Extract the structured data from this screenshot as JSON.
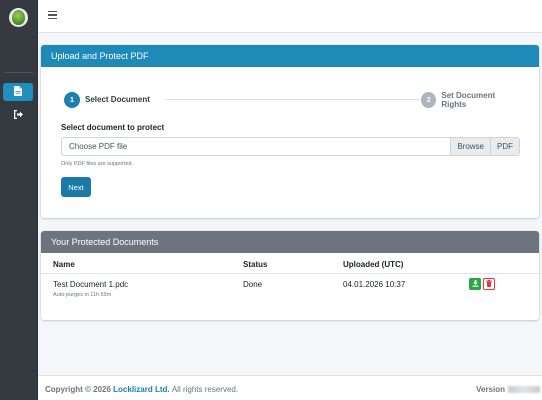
{
  "sidebar": {
    "logo": "app-logo",
    "items": [
      {
        "name": "documents",
        "icon": "file-icon",
        "active": true
      },
      {
        "name": "logout",
        "icon": "sign-out-icon",
        "active": false
      }
    ]
  },
  "topbar": {
    "menu_icon": "hamburger-icon"
  },
  "upload_card": {
    "title": "Upload and Protect PDF",
    "steps": [
      {
        "number": "1",
        "label": "Select Document"
      },
      {
        "number": "2",
        "label": "Set Document Rights"
      }
    ],
    "form_label": "Select document to protect",
    "file_placeholder": "Choose PDF file",
    "browse_label": "Browse",
    "pdf_label": "PDF",
    "help_text": "Only PDF files are supported.",
    "next_label": "Next"
  },
  "docs_card": {
    "title": "Your Protected Documents",
    "columns": [
      "Name",
      "Status",
      "Uploaded (UTC)"
    ],
    "rows": [
      {
        "name": "Test Document 1.pdc",
        "sub": "Auto-purges in 11h 59m",
        "status": "Done",
        "uploaded": "04.01.2026 10:37"
      }
    ]
  },
  "footer": {
    "copyright_prefix": "Copyright © 2026",
    "company": "Locklizard Ltd.",
    "rights": "All rights reserved.",
    "version_label": "Version"
  },
  "colors": {
    "sidebar": "#343a40",
    "primary": "#1d8ab8",
    "secondary_header": "#6c757d",
    "download": "#28a745",
    "delete": "#dc3545"
  }
}
